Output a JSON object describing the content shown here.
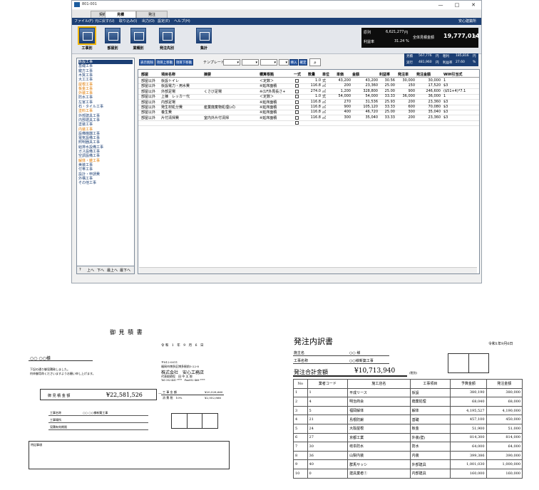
{
  "window": {
    "title": "801-001",
    "controls": [
      "—",
      "□",
      "✕"
    ],
    "tabs": [
      "契約管理",
      "見積",
      "発注"
    ],
    "menu": [
      "ファイル(F)",
      "元に戻す(U)",
      "取り込み(I)",
      "出力(O)",
      "設定(E)",
      "ヘルプ(H)"
    ],
    "menu_right": "安心建築所",
    "toolbar_buttons": [
      {
        "label": "工事別",
        "icon": "trowel-icon",
        "active": true
      },
      {
        "label": "部屋別",
        "icon": "room-icon",
        "active": false
      },
      {
        "label": "業種別",
        "icon": "trade-icon",
        "active": false
      },
      {
        "label": "発注先別",
        "icon": "supplier-icon",
        "active": false
      },
      {
        "label": "集計",
        "icon": "summary-icon",
        "active": false
      }
    ],
    "summary": {
      "genka_label": "原列",
      "genka_value": "6,621,277",
      "genka_unit": "円",
      "rieki_label": "利益率",
      "rieki_value": "31.24",
      "rieki_unit": "%",
      "total_label": "全体見積金額",
      "total_value": "19,777,014",
      "total_unit": "円"
    },
    "subsummary": {
      "r1_l1": "見積",
      "r1_v1": "567,776",
      "r1_u1": "円",
      "r1_l2": "粗利",
      "r1_v2": "185,816",
      "r1_u2": "円",
      "r2_l1": "実行",
      "r2_v1": "481,960",
      "r2_u1": "円",
      "r2_l2": "利益率",
      "r2_v2": "27.60",
      "r2_u2": "%"
    },
    "grid_buttons": [
      "表示削除",
      "項目上移動",
      "項目下移動"
    ],
    "template_label": "テンプレート",
    "insert_label": "挿入",
    "confirm_label": "確定",
    "categories": [
      {
        "label": "仮設工事",
        "color": "#000000",
        "selected": true
      },
      {
        "label": "基礎工事",
        "color": "#1c3f74"
      },
      {
        "label": "鍵方工事",
        "color": "#1c3f74"
      },
      {
        "label": "木質工事",
        "color": "#1c3f74"
      },
      {
        "label": "大工工事",
        "color": "#1c3f74"
      },
      {
        "label": "屋根工事",
        "color": "#e07a00"
      },
      {
        "label": "板金工事",
        "color": "#e07a00"
      },
      {
        "label": "外装工事",
        "color": "#e07a00"
      },
      {
        "label": "防水工事",
        "color": "#1c3f74"
      },
      {
        "label": "左官工事",
        "color": "#1c3f74"
      },
      {
        "label": "石・タイル工事",
        "color": "#1c3f74"
      },
      {
        "label": "塗料工事",
        "color": "#e07a00"
      },
      {
        "label": "外部建具工事",
        "color": "#1c3f74"
      },
      {
        "label": "内部建具工事",
        "color": "#1c3f74"
      },
      {
        "label": "塗装工事",
        "color": "#1c3f74"
      },
      {
        "label": "内装工事",
        "color": "#e07a00"
      },
      {
        "label": "設備機器工事",
        "color": "#1c3f74"
      },
      {
        "label": "電気設備工事",
        "color": "#1c3f74"
      },
      {
        "label": "照明器具工事",
        "color": "#1c3f74"
      },
      {
        "label": "給排水設備工事",
        "color": "#1c3f74"
      },
      {
        "label": "ガス設備工事",
        "color": "#1c3f74"
      },
      {
        "label": "空調設備工事",
        "color": "#1c3f74"
      },
      {
        "label": "解体・雑工事",
        "color": "#e07a00"
      },
      {
        "label": "美装工事",
        "color": "#1c3f74"
      },
      {
        "label": "付帯工事",
        "color": "#1c3f74"
      },
      {
        "label": "設計・申請費",
        "color": "#1c3f74"
      },
      {
        "label": "外構工事",
        "color": "#1c3f74"
      },
      {
        "label": "その他工事",
        "color": "#1c3f74"
      }
    ],
    "cat_nav": [
      "?",
      "上へ",
      "下へ",
      "最上へ",
      "最下へ"
    ],
    "columns": [
      "部屋",
      "項目名称",
      "摘要",
      "積算根拠",
      "一式",
      "数量",
      "単位",
      "単価",
      "金額",
      "利益率",
      "発注単",
      "発注金額",
      "WIH引当式"
    ],
    "rows": [
      [
        "部屋以外",
        "仮設トイレ",
        "",
        "＜定数＞",
        "",
        "1.0",
        "式",
        "43,200",
        "43,200",
        "30.56",
        "30,000",
        "30,000",
        "1"
      ],
      [
        "部屋以外",
        "仮設電力・用水費",
        "",
        "※延床面積",
        "",
        "116.8",
        "㎡",
        "200",
        "23,360",
        "25.00",
        "150",
        "17,520",
        "$3"
      ],
      [
        "部屋以外",
        "外部足場",
        "くさび足場",
        "※(1F外周長さ+",
        "",
        "274.0",
        "㎡",
        "1,200",
        "328,800",
        "25.00",
        "900",
        "246,600",
        "($51+4)*7.1"
      ],
      [
        "部屋以外",
        "上棟　レッカー代",
        "",
        "＜定数＞",
        "",
        "1.0",
        "式",
        "54,000",
        "54,000",
        "33.33",
        "36,000",
        "36,000",
        "1"
      ],
      [
        "部屋以外",
        "内部足場",
        "",
        "※延床面積",
        "",
        "116.8",
        "㎡",
        "270",
        "31,536",
        "25.93",
        "200",
        "23,360",
        "$3"
      ],
      [
        "部屋以外",
        "発生材処分費",
        "産業廃棄物処理(㎥)",
        "※延床面積",
        "",
        "116.8",
        "㎡",
        "900",
        "105,120",
        "33.33",
        "600",
        "70,080",
        "$3"
      ],
      [
        "部屋以外",
        "養生費",
        "",
        "※延床面積",
        "",
        "116.8",
        "㎡",
        "400",
        "46,720",
        "25.00",
        "300",
        "35,040",
        "$3"
      ],
      [
        "部屋以外",
        "片付清掃費",
        "室内外片付清掃",
        "※延床面積",
        "",
        "116.8",
        "㎡",
        "300",
        "35,040",
        "33.33",
        "200",
        "23,360",
        "$3"
      ]
    ]
  },
  "estimate_doc": {
    "title": "御 見 積 書",
    "date": "令 和　1　年　9　月　6　日",
    "recipient": "○○ ○○様",
    "intro1": "下記の通り御見積致しました。",
    "intro2": "何卒御用命くださいますようお願い申し上げます。",
    "company_zip": "〒812-0011",
    "company_addr": "福岡市博多区博多駅前5-22-8",
    "company_name": "株式会社　安心工務店",
    "company_rep": "代表取締役　田 中 太 郎",
    "company_tel": "Tel 092-461-****　Fax092-468-****",
    "total_label": "御 見 積 金 額",
    "total_value": "¥22,581,526",
    "total_dash": "—",
    "tax_label1": "工 事 金 額",
    "tax_value1": "¥20,528,660",
    "tax_label2": "消 費 税　10%",
    "tax_value2": "¥2,052,866",
    "info1_label": "工事名称",
    "info1_value": "○○ ○○様新築工事",
    "info2_label": "工事場所",
    "info3_label": "見積有効期限",
    "remarks_label": "特記事項"
  },
  "order_doc": {
    "title": "発注内訳書",
    "date": "令和1年9月6日",
    "client_label": "施主名",
    "client_value": "○○  様",
    "project_label": "工事名称",
    "project_value": "○○様新築工事",
    "total_label": "発注合計金額",
    "total_value": "¥10,713,940",
    "total_note": "(税別)",
    "columns": [
      "No",
      "業者コード",
      "施工店名",
      "工事項目",
      "予算金額",
      "発注金額"
    ],
    "rows": [
      [
        "1",
        "1",
        "平成リース",
        "仮設",
        "380,190",
        "380,000"
      ],
      [
        "2",
        "4",
        "明治商会",
        "廃棄処理",
        "68,040",
        "68,000"
      ],
      [
        "3",
        "5",
        "福岡解体",
        "解体",
        "4,195,527",
        "4,190,000"
      ],
      [
        "4",
        "21",
        "島根防鍬",
        "基礎",
        "457,100",
        "450,000"
      ],
      [
        "5",
        "24",
        "大阪屋根",
        "板金",
        "51,900",
        "51,000"
      ],
      [
        "6",
        "27",
        "京都工業",
        "外装(壁)",
        "814,300",
        "814,000"
      ],
      [
        "7",
        "30",
        "岐阜防水",
        "防水",
        "64,000",
        "64,000"
      ],
      [
        "8",
        "36",
        "山梨内装",
        "内装",
        "399,386",
        "390,000"
      ],
      [
        "9",
        "40",
        "群馬サッシ",
        "外部建具",
        "1,001,030",
        "1,000,000"
      ],
      [
        "10",
        "0",
        "建具業者①",
        "内部建具",
        "160,000",
        "160,000"
      ]
    ]
  }
}
